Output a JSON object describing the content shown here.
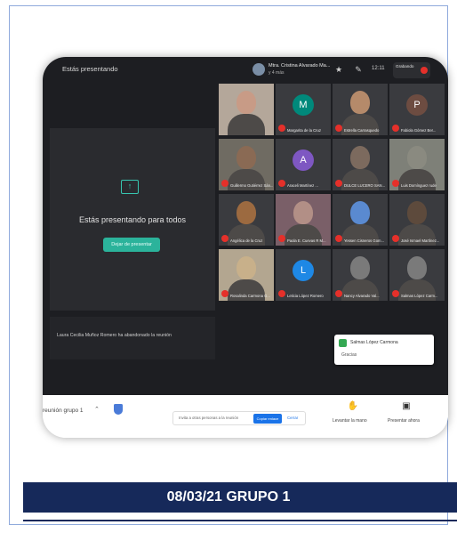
{
  "screen": {
    "presenting_label": "Estás presentando",
    "host_name": "Mtra. Cristina Alvarado Ma...",
    "host_subtitle": "y 4 más",
    "time": "12:11",
    "recording_label": "Grabando",
    "present_title": "Estás presentando para todos",
    "stop_button": "Dejar de presentar",
    "screen_note": "Laura Cecilia Muñoz Romero ha abandonado la reunión",
    "meeting_code": "reunión grupo 1",
    "join_hint": "Invita a otras personas a la reunión",
    "join_button": "Copiar enlace",
    "join_close": "Cerrar",
    "raise_hand_label": "Levantar la mano",
    "present_now_label": "Presentar ahora",
    "popup_name": "Salmas López Carmona",
    "popup_msg": "Gracias"
  },
  "participants": [
    {
      "name": "",
      "initial": "",
      "color": "#c89b86",
      "bg": "#b4a79a"
    },
    {
      "name": "Margarita de la Cruz",
      "initial": "M",
      "color": "#00897b",
      "bg": "#3a3b3f"
    },
    {
      "name": "Estrella Carrasquedo",
      "initial": "",
      "color": "#b58a6a",
      "bg": "#3a3b3f"
    },
    {
      "name": "Fabiola Gómez Ber...",
      "initial": "P",
      "color": "#6d4c41",
      "bg": "#3a3b3f"
    },
    {
      "name": "Guillermo Gutiérrez Sán...",
      "initial": "",
      "color": "#8a6a54",
      "bg": "#6f6b62"
    },
    {
      "name": "Araceli Martínez ...",
      "initial": "A",
      "color": "#7e57c2",
      "bg": "#3a3b3f"
    },
    {
      "name": "DULCE LUCERO SAN...",
      "initial": "",
      "color": "#7c6a5e",
      "bg": "#3a3b3f"
    },
    {
      "name": "Luis Domínguez rude",
      "initial": "",
      "color": "#8a8a80",
      "bg": "#7e8078"
    },
    {
      "name": "Angélica de la Cruz",
      "initial": "",
      "color": "#9c6a40",
      "bg": "#3a3b3f"
    },
    {
      "name": "Paola E. Cuevas R M...",
      "initial": "",
      "color": "#b28f86",
      "bg": "#7a5f68"
    },
    {
      "name": "Yessen Cisneros Gom...",
      "initial": "",
      "color": "#5a8ad0",
      "bg": "#3a3b3f"
    },
    {
      "name": "José Ismael Martínez...",
      "initial": "",
      "color": "#5d4a3c",
      "bg": "#3a3b3f"
    },
    {
      "name": "Rosalinda Carmona G...",
      "initial": "",
      "color": "#c8b08a",
      "bg": "#b3a690"
    },
    {
      "name": "Leticia López Romero",
      "initial": "L",
      "color": "#1e88e5",
      "bg": "#3a3b3f"
    },
    {
      "name": "Nancy Alvarado Val...",
      "initial": "",
      "color": "#7a7a7a",
      "bg": "#3a3b3f"
    },
    {
      "name": "Salmas López Carm...",
      "initial": "",
      "color": "#7a7a7a",
      "bg": "#3a3b3f"
    }
  ],
  "caption": "08/03/21 GRUPO 1"
}
